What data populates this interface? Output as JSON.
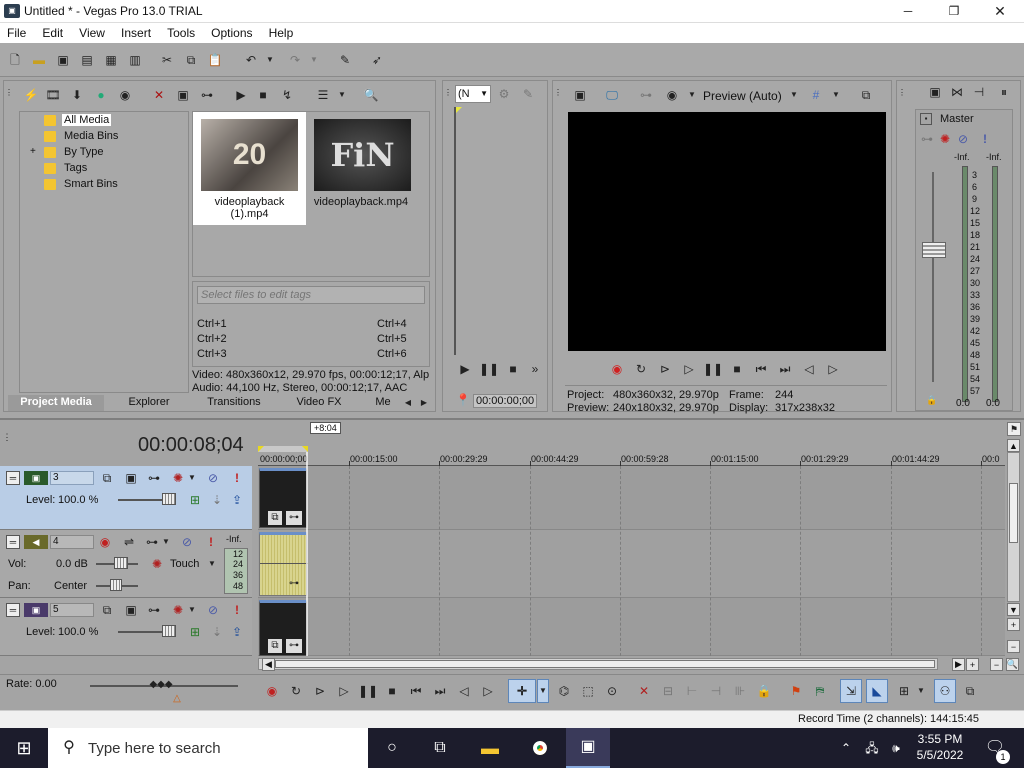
{
  "window": {
    "title": "Untitled * - Vegas Pro 13.0 TRIAL",
    "minimize": "─",
    "restore": "❐",
    "close": "✕"
  },
  "menu": [
    "File",
    "Edit",
    "View",
    "Insert",
    "Tools",
    "Options",
    "Help"
  ],
  "media": {
    "tree": [
      {
        "label": "All Media",
        "expander": ""
      },
      {
        "label": "Media Bins",
        "expander": ""
      },
      {
        "label": "By Type",
        "expander": "+"
      },
      {
        "label": "Tags",
        "expander": ""
      },
      {
        "label": "Smart Bins",
        "expander": ""
      }
    ],
    "files": [
      {
        "name": "videoplayback\n(1).mp4",
        "thumb_text": "20"
      },
      {
        "name": "videoplayback.mp4",
        "thumb_text": "FiN"
      }
    ],
    "tags_placeholder": "Select files to edit tags",
    "shortcuts": [
      "Ctrl+1",
      "Ctrl+2",
      "Ctrl+3",
      "Ctrl+4",
      "Ctrl+5",
      "Ctrl+6"
    ],
    "info_video": "Video: 480x360x12, 29.970 fps, 00:00:12;17, Alp",
    "info_audio": "Audio: 44,100 Hz, Stereo, 00:00:12;17, AAC"
  },
  "tabs": [
    "Project Media",
    "Explorer",
    "Transitions",
    "Video FX",
    "Me"
  ],
  "trimmer": {
    "select_value": "(N",
    "timecode": "00:00:00;00"
  },
  "preview": {
    "mode_label": "Preview (Auto)",
    "project_label": "Project:",
    "project_value": "480x360x32, 29.970p",
    "preview_label": "Preview:",
    "preview_value": "240x180x32, 29.970p",
    "frame_label": "Frame:",
    "frame_value": "244",
    "display_label": "Display:",
    "display_value": "317x238x32"
  },
  "master": {
    "label": "Master",
    "inf_left": "-Inf.",
    "inf_right": "-Inf.",
    "scale": [
      "3",
      "6",
      "9",
      "12",
      "15",
      "18",
      "21",
      "24",
      "27",
      "30",
      "33",
      "36",
      "39",
      "42",
      "45",
      "48",
      "51",
      "54",
      "57"
    ],
    "val_left": "0.0",
    "val_right": "0.0"
  },
  "timeline": {
    "timecode": "00:00:08;04",
    "offset_badge": "+8:04",
    "ruler": [
      "00:00:00;00",
      "00:00:15:00",
      "00:00:29:29",
      "00:00:44:29",
      "00:00:59:28",
      "00:01:15:00",
      "00:01:29:29",
      "00:01:44:29",
      "00:0"
    ],
    "tracks": [
      {
        "num": "3",
        "kind": "video",
        "level_label": "Level:",
        "level_value": "100.0 %"
      },
      {
        "num": "4",
        "kind": "audio",
        "vol_label": "Vol:",
        "vol_value": "0.0 dB",
        "pan_label": "Pan:",
        "pan_value": "Center",
        "mode": "Touch",
        "meter_inf": "-Inf.",
        "meter_scale": [
          "12",
          "24",
          "36",
          "48"
        ]
      },
      {
        "num": "5",
        "kind": "video",
        "level_label": "Level:",
        "level_value": "100.0 %"
      }
    ],
    "rate": "Rate: 0.00",
    "record_time": "Record Time (2 channels): 144:15:45"
  },
  "taskbar": {
    "search_placeholder": "Type here to search",
    "time": "3:55 PM",
    "date": "5/5/2022",
    "notification_count": "1"
  },
  "colors": {
    "accent": "#5d86b9",
    "video_track": "#b9cde6",
    "audio_wave": "#d8d48e",
    "record": "#d02020"
  }
}
